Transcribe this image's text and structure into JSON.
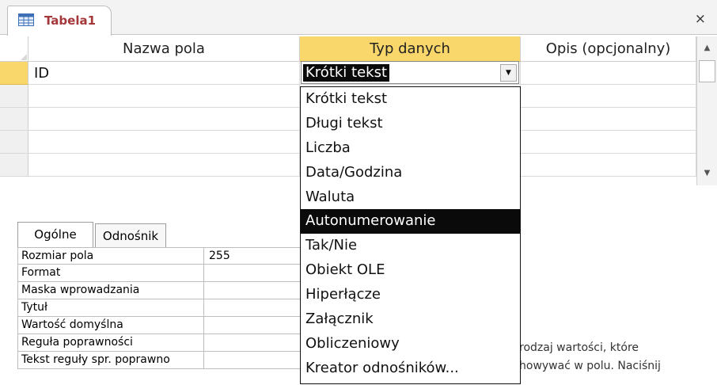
{
  "document_tab": {
    "title": "Tabela1",
    "icon": "table-icon",
    "close_label": "×"
  },
  "grid": {
    "columns": [
      "Nazwa pola",
      "Typ danych",
      "Opis (opcjonalny)"
    ],
    "active_column": "Typ danych",
    "rows": [
      {
        "field_name": "ID",
        "data_type": "Krótki tekst",
        "description": "",
        "is_primary_key": true
      },
      {
        "field_name": "",
        "data_type": "",
        "description": ""
      },
      {
        "field_name": "",
        "data_type": "",
        "description": ""
      },
      {
        "field_name": "",
        "data_type": "",
        "description": ""
      },
      {
        "field_name": "",
        "data_type": "",
        "description": ""
      }
    ]
  },
  "data_type_dropdown": {
    "current_value": "Krótki tekst",
    "highlighted": "Autonumerowanie",
    "options": [
      "Krótki tekst",
      "Długi tekst",
      "Liczba",
      "Data/Godzina",
      "Waluta",
      "Autonumerowanie",
      "Tak/Nie",
      "Obiekt OLE",
      "Hiperłącze",
      "Załącznik",
      "Obliczeniowy",
      "Kreator odnośników..."
    ]
  },
  "field_properties": {
    "tabs": [
      "Ogólne",
      "Odnośnik"
    ],
    "active_tab": "Ogólne",
    "rows": [
      {
        "label": "Rozmiar pola",
        "value": "255"
      },
      {
        "label": "Format",
        "value": ""
      },
      {
        "label": "Maska wprowadzania",
        "value": ""
      },
      {
        "label": "Tytuł",
        "value": ""
      },
      {
        "label": "Wartość domyślna",
        "value": ""
      },
      {
        "label": "Reguła poprawności",
        "value": ""
      },
      {
        "label": "Tekst reguły spr. poprawno",
        "value": ""
      }
    ]
  },
  "help_text": {
    "line1": "rodzaj wartości, które",
    "line2": "howywać w polu. Naciśnij"
  },
  "colors": {
    "accent_header": "#f9d76a",
    "tab_title": "#a4373a",
    "selection": "#0a0a0a"
  }
}
